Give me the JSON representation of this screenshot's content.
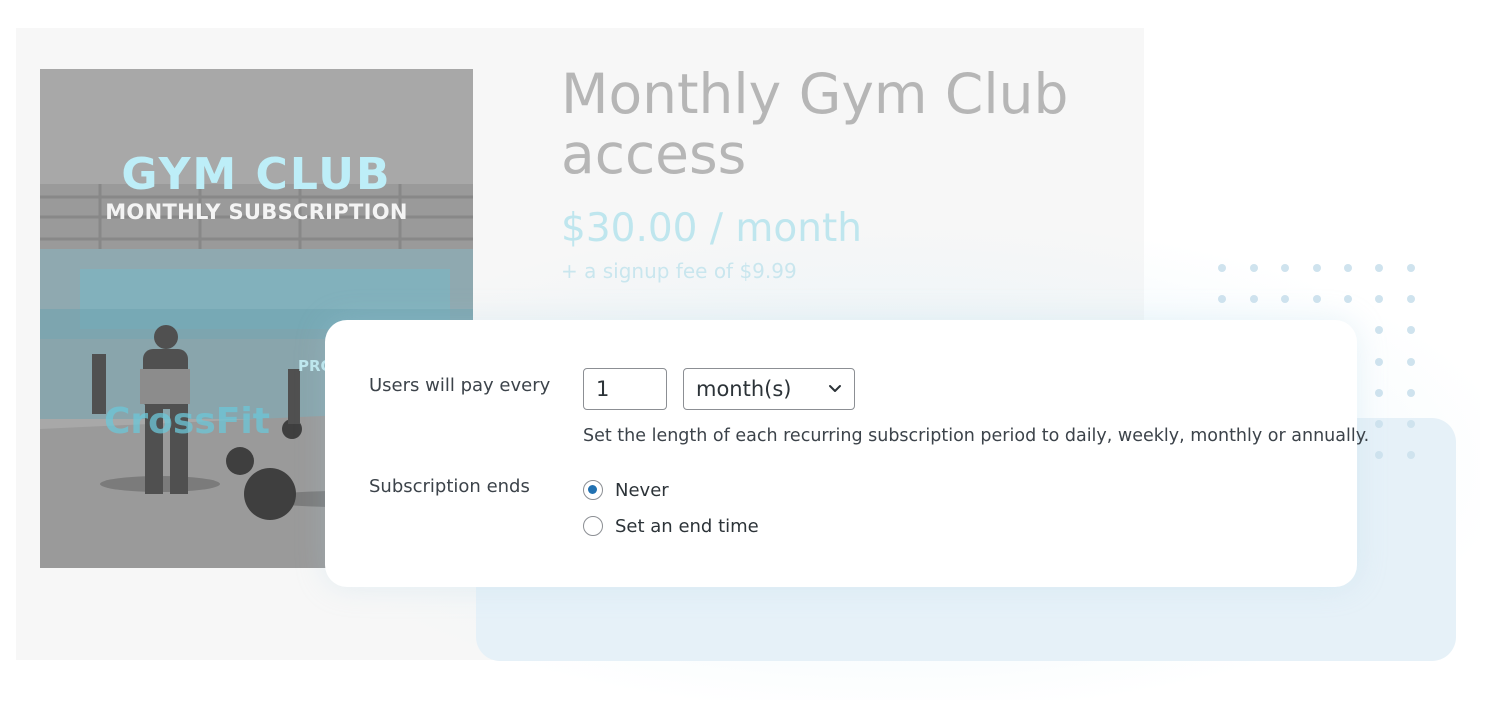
{
  "hero": {
    "title": "GYM CLUB",
    "subtitle": "MONTHLY SUBSCRIPTION",
    "sign_text": "PROGENEX",
    "wall_text": "CrossFit"
  },
  "product": {
    "title": "Monthly Gym Club access",
    "price": "$30.00 / month",
    "signup_fee": "+ a signup fee of $9.99"
  },
  "settings": {
    "billing_label": "Users will pay every",
    "interval_value": "1",
    "period_selected": "month(s)",
    "help_text": "Set the length of each recurring subscription period to daily, weekly, monthly or annually.",
    "ends_label": "Subscription ends",
    "ends_options": [
      {
        "label": "Never",
        "checked": true
      },
      {
        "label": "Set an end time",
        "checked": false
      }
    ]
  },
  "colors": {
    "accent": "#2271b1",
    "price": "#bfe6ee",
    "background_panel": "#e6f1f8"
  }
}
